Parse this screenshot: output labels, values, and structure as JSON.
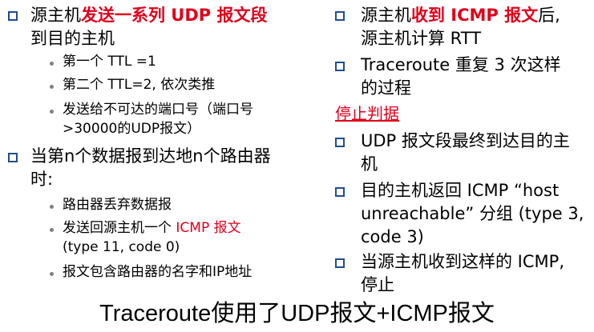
{
  "left": {
    "item1": {
      "pre": "源主机",
      "highlight": "发送一系列 UDP 报文段",
      "line2": "到目的主机",
      "subs": [
        "第一个 TTL =1",
        "第二个 TTL=2, 依次类推"
      ],
      "sub3_line1": "发送给不可达的端口号（端口号",
      "sub3_line2": ">30000的UDP报文）"
    },
    "item2": {
      "line1": "当第n个数据报到达地n个路由器",
      "line2": "时:",
      "sub1": "路由器丢弃数据报",
      "sub2_pre": "发送回源主机一个 ",
      "sub2_highlight": "ICMP 报文",
      "sub2_line2": "(type 11, code 0)",
      "sub3": "报文包含路由器的名字和IP地址"
    }
  },
  "right": {
    "item1": {
      "pre": "源主机",
      "highlight": "收到 ICMP 报文",
      "post": "后,",
      "line2": "源主机计算 RTT"
    },
    "item2": {
      "line1": "Traceroute 重复 3 次这样",
      "line2": "的过程"
    },
    "stop_title": "停止判据",
    "item3": {
      "line1": "UDP 报文段最终到达目的主",
      "line2": "机"
    },
    "item4": {
      "line1": "目的主机返回 ICMP “host",
      "line2": "unreachable” 分组 (type 3,",
      "line3": "code 3)"
    },
    "item5": {
      "line1": "当源主机收到这样的 ICMP,",
      "line2": "停止"
    }
  },
  "footer": "Traceroute使用了UDP报文+ICMP报文",
  "colors": {
    "highlight": "#e0001b",
    "bullet": "#1f4e8c",
    "dot": "#808080"
  }
}
